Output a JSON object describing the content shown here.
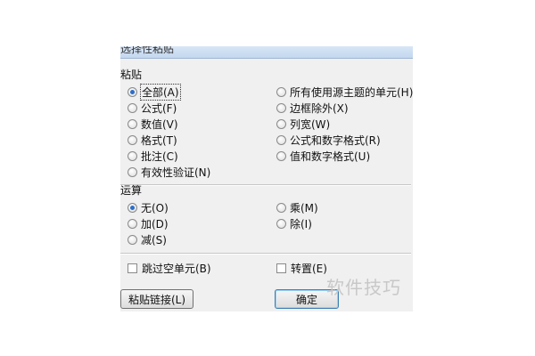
{
  "dialog": {
    "title": "选择性粘贴",
    "paste_group_label": "粘贴",
    "paste_options": [
      {
        "label": "全部(A)",
        "checked": true
      },
      {
        "label": "公式(F)",
        "checked": false
      },
      {
        "label": "数值(V)",
        "checked": false
      },
      {
        "label": "格式(T)",
        "checked": false
      },
      {
        "label": "批注(C)",
        "checked": false
      },
      {
        "label": "有效性验证(N)",
        "checked": false
      },
      {
        "label": "所有使用源主题的单元(H)",
        "checked": false
      },
      {
        "label": "边框除外(X)",
        "checked": false
      },
      {
        "label": "列宽(W)",
        "checked": false
      },
      {
        "label": "公式和数字格式(R)",
        "checked": false
      },
      {
        "label": "值和数字格式(U)",
        "checked": false
      }
    ],
    "operation_group_label": "运算",
    "operation_options": [
      {
        "label": "无(O)",
        "checked": true
      },
      {
        "label": "加(D)",
        "checked": false
      },
      {
        "label": "减(S)",
        "checked": false
      },
      {
        "label": "乘(M)",
        "checked": false
      },
      {
        "label": "除(I)",
        "checked": false
      }
    ],
    "skip_blanks_label": "跳过空单元(B)",
    "skip_blanks_checked": false,
    "transpose_label": "转置(E)",
    "transpose_checked": false,
    "paste_link_button": "粘贴链接(L)",
    "ok_button": "确定"
  },
  "watermark": "软件技巧"
}
